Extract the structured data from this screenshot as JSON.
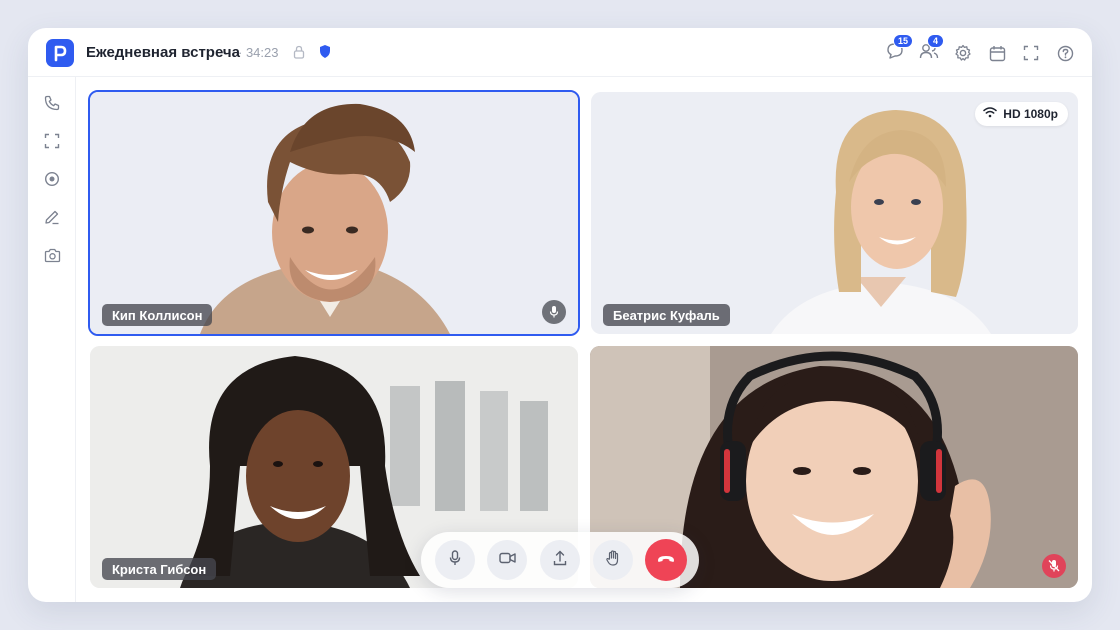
{
  "app": {
    "title": "Ежедневная встреча",
    "timer": "· 34:23",
    "chat_count": "15",
    "participants_count": "4"
  },
  "participants": [
    {
      "name": "Кип Коллисон",
      "mic": "on",
      "active": true
    },
    {
      "name": "Беатрис Куфаль",
      "quality": "HD 1080p"
    },
    {
      "name": "Криста Гибсон"
    },
    {
      "name": "",
      "mic": "muted"
    }
  ],
  "icons": {
    "topbar": [
      "app-logo-icon",
      "lock-icon",
      "shield-icon",
      "chat-icon",
      "participants-icon",
      "settings-icon",
      "calendar-icon",
      "fullscreen-icon",
      "help-icon"
    ],
    "sidebar": [
      "phone-icon",
      "screen-capture-icon",
      "record-icon",
      "pen-icon",
      "camera-icon"
    ],
    "controls": [
      "microphone-icon",
      "video-icon",
      "share-screen-icon",
      "raise-hand-icon",
      "end-call-icon"
    ]
  },
  "colors": {
    "accent": "#2f5bf0",
    "end_call": "#ef4456",
    "muted": "#e0445a"
  }
}
